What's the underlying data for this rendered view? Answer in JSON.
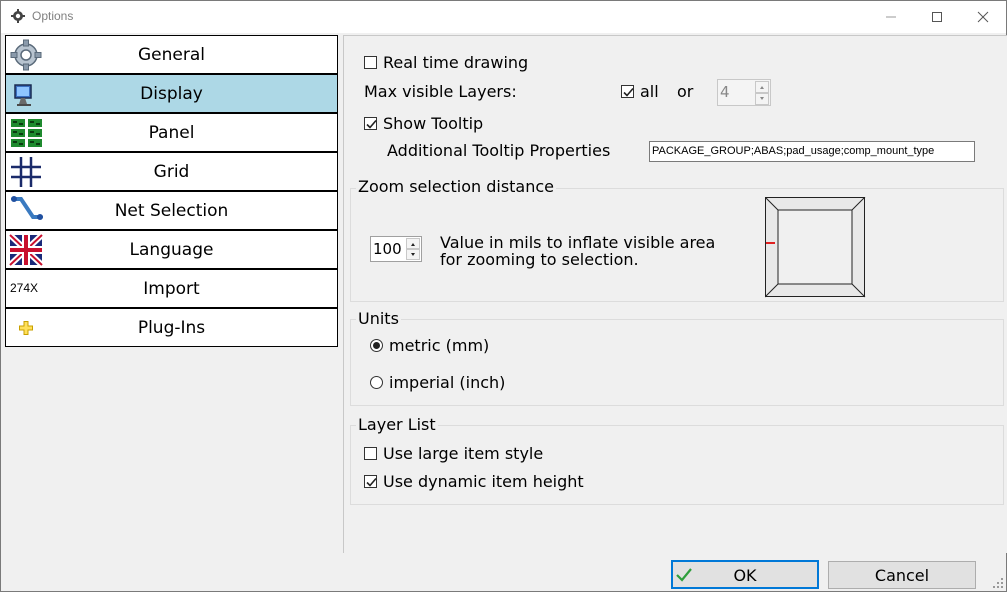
{
  "window": {
    "title": "Options"
  },
  "sidebar": {
    "items": [
      {
        "label": "General",
        "icon": "gear-icon",
        "selected": false
      },
      {
        "label": "Display",
        "icon": "monitor-icon",
        "selected": true
      },
      {
        "label": "Panel",
        "icon": "panel-icon",
        "selected": false
      },
      {
        "label": "Grid",
        "icon": "grid-icon",
        "selected": false
      },
      {
        "label": "Net Selection",
        "icon": "net-icon",
        "selected": false
      },
      {
        "label": "Language",
        "icon": "uk-flag-icon",
        "selected": false
      },
      {
        "label": "Import",
        "icon": "import-icon",
        "icon_text": "274X",
        "selected": false
      },
      {
        "label": "Plug-Ins",
        "icon": "plus-icon",
        "selected": false
      }
    ]
  },
  "display": {
    "real_time_drawing": {
      "label": "Real time drawing",
      "checked": false
    },
    "max_visible_layers": {
      "label": "Max visible Layers:",
      "all_label": "all",
      "all_checked": true,
      "or_label": "or",
      "value": "4"
    },
    "show_tooltip": {
      "label": "Show Tooltip",
      "checked": true
    },
    "additional_tooltip": {
      "label": "Additional Tooltip Properties",
      "value": "PACKAGE_GROUP;ABAS;pad_usage;comp_mount_type"
    }
  },
  "zoom": {
    "title": "Zoom selection distance",
    "value": "100",
    "description_line1": "Value in mils to inflate visible area",
    "description_line2": "for zooming to selection."
  },
  "units": {
    "title": "Units",
    "options": [
      {
        "label": "metric (mm)",
        "selected": true
      },
      {
        "label": "imperial (inch)",
        "selected": false
      }
    ]
  },
  "layer_list": {
    "title": "Layer List",
    "large_item_style": {
      "label": "Use large item style",
      "checked": false
    },
    "dynamic_item_height": {
      "label": "Use dynamic item height",
      "checked": true
    }
  },
  "footer": {
    "ok_label": "OK",
    "cancel_label": "Cancel"
  },
  "colors": {
    "selected_bg": "#add8e6",
    "accent": "#0078d7",
    "check_green": "#2e9e3c"
  }
}
